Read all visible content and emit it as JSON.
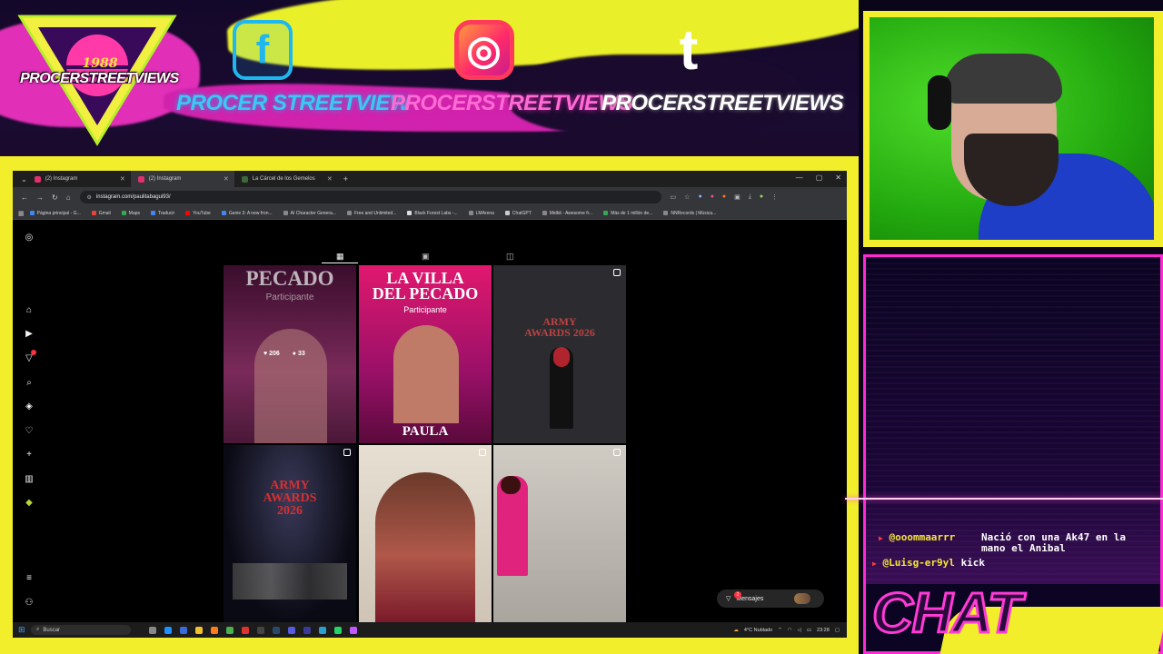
{
  "overlay": {
    "logo": {
      "year": "1988",
      "name": "PROCERSTREETVIEWS"
    },
    "socials": [
      {
        "platform": "facebook",
        "icon": "facebook-icon",
        "glyph": "f",
        "handle": "PROCER STREETVIEW"
      },
      {
        "platform": "instagram",
        "icon": "instagram-icon",
        "glyph": "◎",
        "handle": "PROCERSTREETVIEWS"
      },
      {
        "platform": "tumblr",
        "icon": "tumblr-icon",
        "glyph": "t",
        "handle": "PROCERSTREETVIEWS"
      }
    ],
    "chat_title": "CHAT",
    "chat_messages": [
      {
        "user": "@ooommaarrr",
        "text": "Nació con una Ak47 en la mano el Anibal"
      },
      {
        "user": "@Luisg-er9yl",
        "text": "kick"
      }
    ],
    "colors": {
      "frame": "#f3ee2b",
      "accent": "#ff2ad4",
      "cam_bg": "#22a80e"
    }
  },
  "browser": {
    "tabs": [
      {
        "label": "(2) Instagram",
        "active": false
      },
      {
        "label": "(2) Instagram",
        "active": true
      },
      {
        "label": "La Cárcel de los Gemelos",
        "active": false
      }
    ],
    "new_tab": "+",
    "url": "instagram.com/paulitabagui93/",
    "bookmarks": [
      {
        "label": "Página principal - G...",
        "color": "#4285f4"
      },
      {
        "label": "Gmail",
        "color": "#ea4335"
      },
      {
        "label": "Maps",
        "color": "#34a853"
      },
      {
        "label": "Traducir",
        "color": "#4285f4"
      },
      {
        "label": "YouTube",
        "color": "#ff0000"
      },
      {
        "label": "Genie 3: A new fron...",
        "color": "#4285f4"
      },
      {
        "label": "AI Character Genera...",
        "color": "#888888"
      },
      {
        "label": "Free and Unlimited...",
        "color": "#888888"
      },
      {
        "label": "Black Forest Labs -...",
        "color": "#dddddd"
      },
      {
        "label": "LMArena",
        "color": "#888888"
      },
      {
        "label": "ChatGPT",
        "color": "#cccccc"
      },
      {
        "label": "Midkit - Awesome fr...",
        "color": "#888888"
      },
      {
        "label": "Más de 1 millón de...",
        "color": "#34a853"
      },
      {
        "label": "NNRecords | Música...",
        "color": "#888888"
      }
    ]
  },
  "instagram": {
    "post_stats": {
      "likes": "206",
      "comments": "33"
    },
    "posts": [
      {
        "title": "PECADO",
        "subtitle": "Participante",
        "bg": "#5a1040"
      },
      {
        "title": "LA VILLA DEL PECADO",
        "subtitle": "Participante",
        "name": "PAULA",
        "bg": "#c0146e"
      },
      {
        "title": "ARMY AWARDS 2026",
        "bg": "#2c2c30"
      },
      {
        "title": "ARMY AWARDS 2026",
        "bg": "#181822"
      },
      {
        "title": "",
        "bg": "#d9cfc2"
      },
      {
        "title": "",
        "bg": "#bcb8b0"
      }
    ],
    "messages_label": "Mensajes",
    "notif_count": "2"
  },
  "taskbar": {
    "search_placeholder": "Buscar",
    "weather": "4°C  Nublado",
    "time": "23:28"
  }
}
